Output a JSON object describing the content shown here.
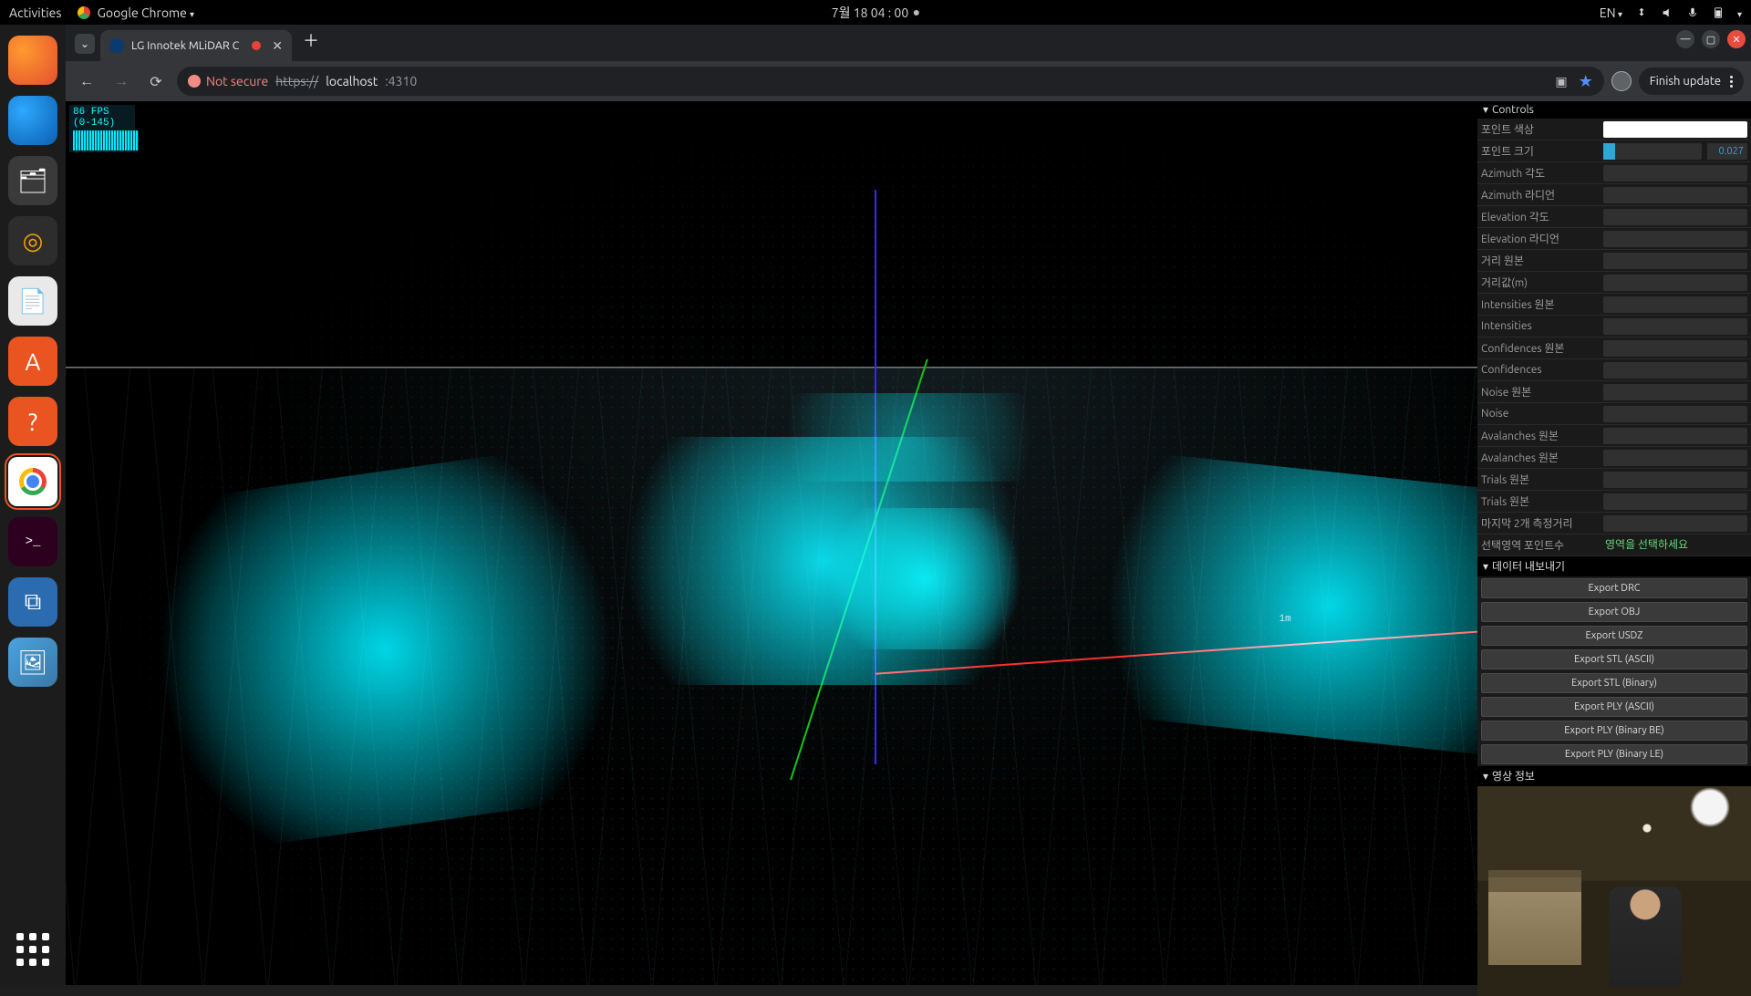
{
  "gnome": {
    "activities": "Activities",
    "app_menu": "Google Chrome",
    "clock": "7월 18  04 : 00",
    "lang": "EN"
  },
  "tab": {
    "title": "LG Innotek MLiDAR C"
  },
  "toolbar": {
    "not_secure": "Not secure",
    "url_protocol": "https://",
    "url_host": "localhost",
    "url_port": ":4310",
    "finish_update": "Finish update"
  },
  "stats": {
    "line": "86 FPS (0-145)"
  },
  "scene": {
    "axis_1m": "1m"
  },
  "gui": {
    "controls_title": "Controls",
    "export_title": "데이터 내보내기",
    "video_title": "영상 정보",
    "rows": {
      "point_color": "포인트 색상",
      "point_size": "포인트 크기",
      "point_size_val": "0.027",
      "azimuth_deg": "Azimuth 각도",
      "azimuth_rad": "Azimuth 라디언",
      "elevation_deg": "Elevation 각도",
      "elevation_rad": "Elevation 라디언",
      "dist_raw": "거리 원본",
      "dist_m": "거리값(m)",
      "intens_raw": "Intensities 원본",
      "intens": "Intensities",
      "conf_raw": "Confidences 원본",
      "conf": "Confidences",
      "noise_raw": "Noise 원본",
      "noise": "Noise",
      "aval_raw": "Avalanches 원본",
      "aval_raw2": "Avalanches 원본",
      "trials_raw": "Trials 원본",
      "trials_raw2": "Trials 원본",
      "last2": "마지막 2개 측정거리",
      "sel_points": "선택영역 포인트수",
      "sel_points_msg": "영역을 선택하세요"
    },
    "export": {
      "drc": "Export DRC",
      "obj": "Export OBJ",
      "usdz": "Export USDZ",
      "stl_ascii": "Export STL (ASCII)",
      "stl_bin": "Export STL (Binary)",
      "ply_ascii": "Export PLY (ASCII)",
      "ply_be": "Export PLY (Binary BE)",
      "ply_le": "Export PLY (Binary LE)"
    }
  }
}
